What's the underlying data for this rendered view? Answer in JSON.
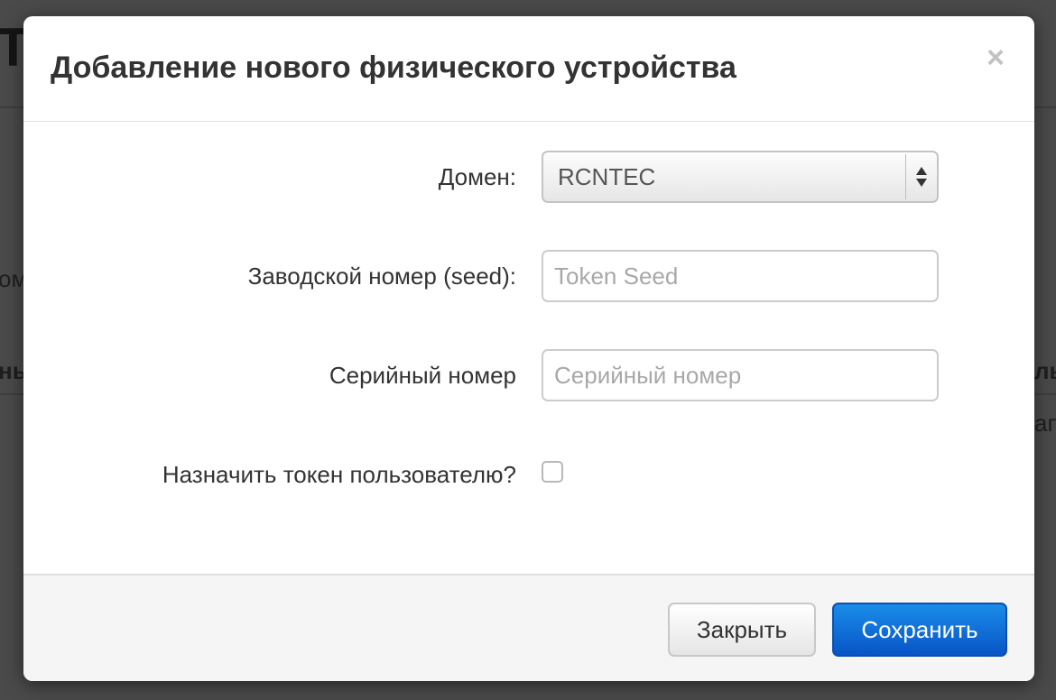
{
  "background": {
    "fragments": [
      "ом",
      "ны",
      "ль",
      "ап"
    ],
    "big_char": "Т"
  },
  "modal": {
    "title": "Добавление нового физического устройства",
    "close_glyph": "×"
  },
  "form": {
    "domain": {
      "label": "Домен:",
      "value": "RCNTEC"
    },
    "seed": {
      "label": "Заводской номер (seed):",
      "placeholder": "Token Seed"
    },
    "serial": {
      "label": "Серийный номер",
      "placeholder": "Серийный номер"
    },
    "assign": {
      "label": "Назначить токен пользователю?",
      "checked": false
    }
  },
  "footer": {
    "close_label": "Закрыть",
    "save_label": "Сохранить"
  },
  "colors": {
    "primary": "#0a62d4",
    "backdrop": "#454545"
  },
  "icons": {
    "close": "close-icon",
    "select_arrows": "select-arrows-icon"
  }
}
